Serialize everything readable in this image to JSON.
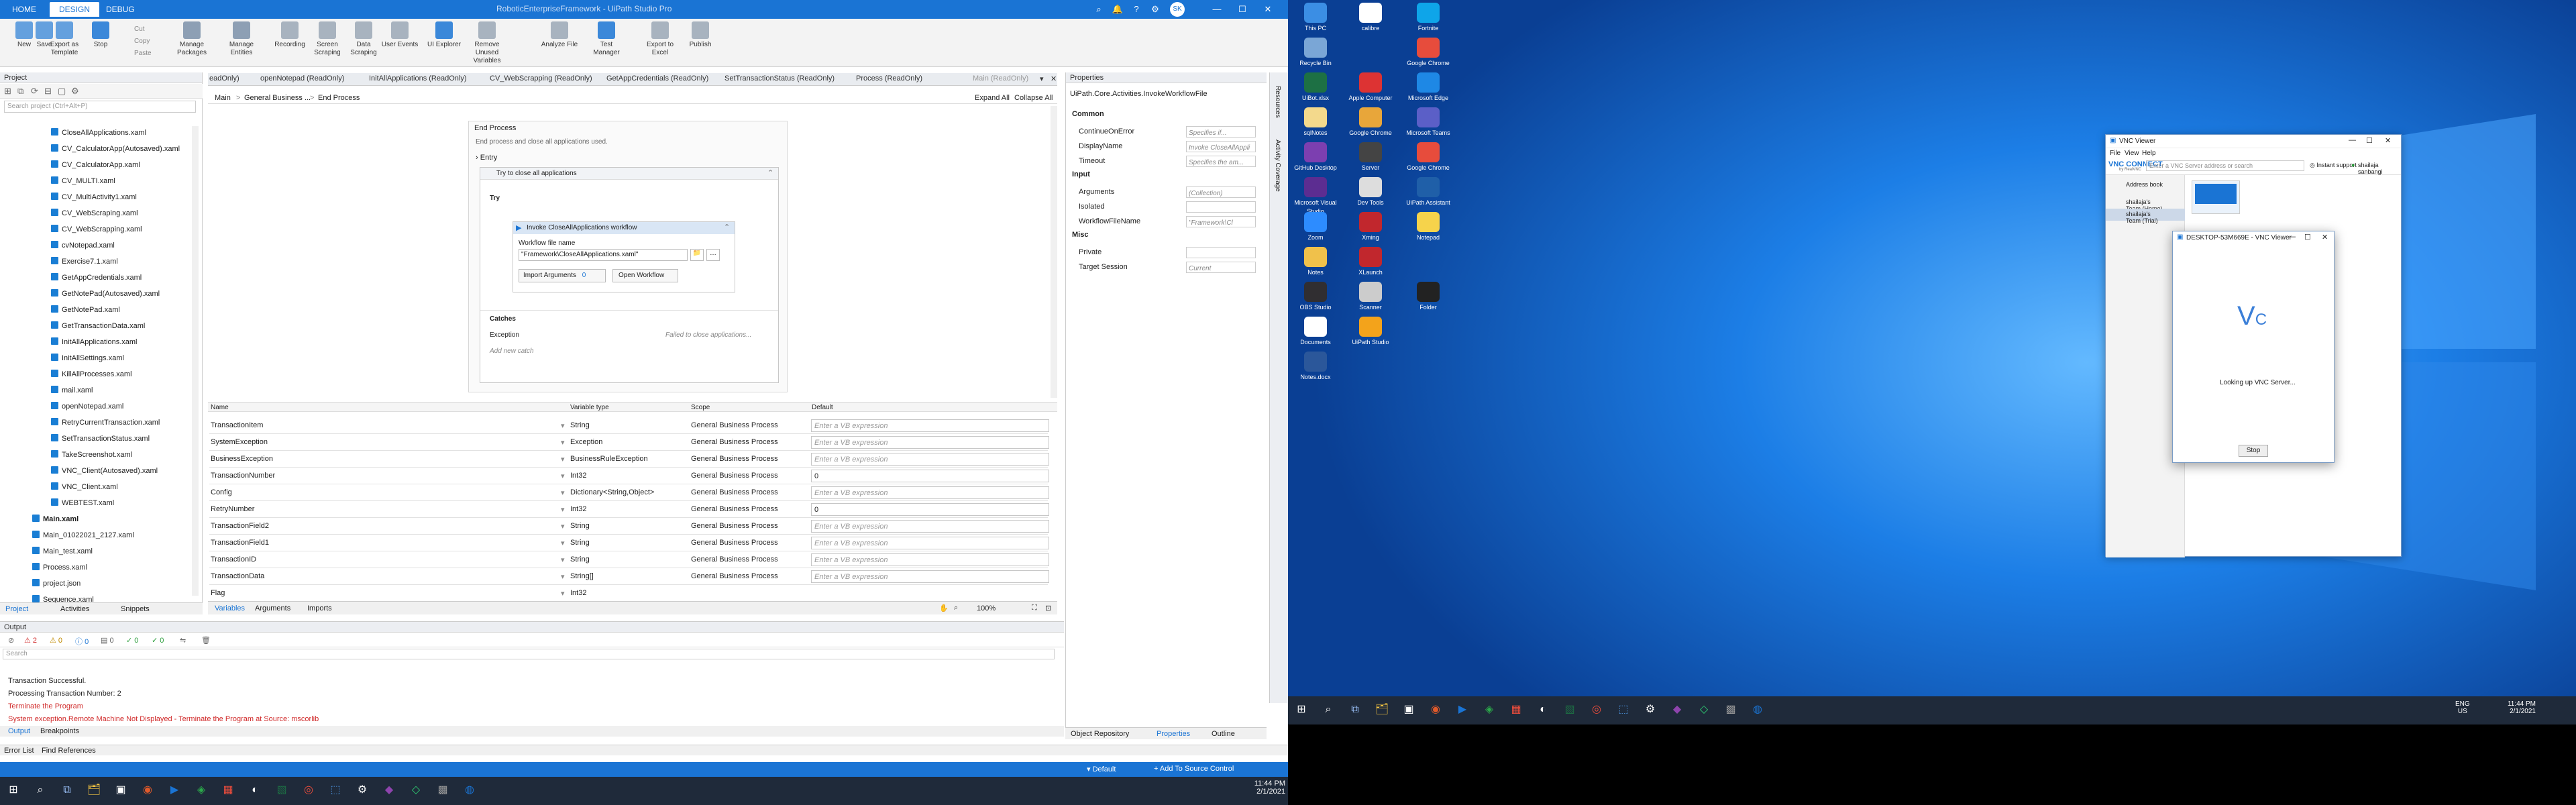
{
  "studio": {
    "title": "RoboticEnterpriseFramework - UiPath Studio Pro",
    "tabs": [
      "HOME",
      "DESIGN",
      "DEBUG"
    ],
    "user_initials": "SK",
    "ribbon": [
      {
        "label": "New",
        "icon": "new-icon"
      },
      {
        "label": "Save",
        "icon": "save-icon"
      },
      {
        "label": "Export as Template",
        "icon": "export-icon"
      },
      {
        "label": "Stop",
        "icon": "stop-icon"
      },
      {
        "label": "Manage Packages",
        "icon": "packages-icon"
      },
      {
        "label": "Manage Entities",
        "icon": "entities-icon"
      },
      {
        "label": "Recording",
        "icon": "recording-icon"
      },
      {
        "label": "Screen Scraping",
        "icon": "screen-scraping-icon"
      },
      {
        "label": "Data Scraping",
        "icon": "data-scraping-icon"
      },
      {
        "label": "User Events",
        "icon": "user-events-icon"
      },
      {
        "label": "UI Explorer",
        "icon": "ui-explorer-icon"
      },
      {
        "label": "Remove Unused Variables",
        "icon": "remove-variables-icon"
      },
      {
        "label": "Analyze File",
        "icon": "analyze-icon"
      },
      {
        "label": "Test Manager",
        "icon": "test-manager-icon"
      },
      {
        "label": "Export to Excel",
        "icon": "excel-export-icon"
      },
      {
        "label": "Publish",
        "icon": "publish-icon"
      }
    ],
    "ribbon_small": [
      "Cut",
      "Copy",
      "Paste"
    ],
    "project": {
      "header": "Project",
      "search_placeholder": "Search project (Ctrl+Alt+P)",
      "files": [
        "CloseAllApplications.xaml",
        "CV_CalculatorApp(Autosaved).xaml",
        "CV_CalculatorApp.xaml",
        "CV_MULTI.xaml",
        "CV_MultiActivity1.xaml",
        "CV_WebScraping.xaml",
        "CV_WebScrapping.xaml",
        "cvNotepad.xaml",
        "Exercise7.1.xaml",
        "GetAppCredentials.xaml",
        "GetNotePad(Autosaved).xaml",
        "GetNotePad.xaml",
        "GetTransactionData.xaml",
        "InitAllApplications.xaml",
        "InitAllSettings.xaml",
        "KillAllProcesses.xaml",
        "mail.xaml",
        "openNotepad.xaml",
        "RetryCurrentTransaction.xaml",
        "SetTransactionStatus.xaml",
        "TakeScreenshot.xaml",
        "VNC_Client(Autosaved).xaml",
        "VNC_Client.xaml",
        "WEBTEST.xaml",
        "Main.xaml",
        "Main_01022021_2127.xaml",
        "Main_test.xaml",
        "Process.xaml",
        "project.json",
        "Sequence.xaml"
      ],
      "bottom_tabs": [
        "Project",
        "Activities",
        "Snippets"
      ]
    },
    "doc_tabs": [
      "eadOnly)",
      "openNotepad (ReadOnly)",
      "InitAllApplications (ReadOnly)",
      "CV_WebScrapping (ReadOnly)",
      "GetAppCredentials (ReadOnly)",
      "SetTransactionStatus (ReadOnly)",
      "Process (ReadOnly)",
      "Main (ReadOnly)"
    ],
    "breadcrumb": [
      "Main",
      "General Business ...",
      "End Process"
    ],
    "expand_all": "Expand All",
    "collapse_all": "Collapse All",
    "workflow": {
      "state_title": "End Process",
      "state_desc": "End process and close all applications used.",
      "entry": "Entry",
      "try_catch_title": "Try to close all applications",
      "try_label": "Try",
      "invoke_title": "Invoke CloseAllApplications workflow",
      "file_name_label": "Workflow file name",
      "file_name_value": "\"Framework\\CloseAllApplications.xaml\"",
      "import_args": "Import Arguments",
      "import_args_count": "0",
      "open_workflow": "Open Workflow",
      "catches": "Catches",
      "exception": "Exception",
      "exception_msg": "Failed to close applications...",
      "add_catch": "Add new catch"
    },
    "variables": {
      "headers": [
        "Name",
        "Variable type",
        "Scope",
        "Default"
      ],
      "rows": [
        {
          "name": "TransactionItem",
          "type": "String",
          "scope": "General Business Process",
          "default": "Enter a VB expression",
          "placeholder": true
        },
        {
          "name": "SystemException",
          "type": "Exception",
          "scope": "General Business Process",
          "default": "Enter a VB expression",
          "placeholder": true
        },
        {
          "name": "BusinessException",
          "type": "BusinessRuleException",
          "scope": "General Business Process",
          "default": "Enter a VB expression",
          "placeholder": true
        },
        {
          "name": "TransactionNumber",
          "type": "Int32",
          "scope": "General Business Process",
          "default": "0",
          "placeholder": false
        },
        {
          "name": "Config",
          "type": "Dictionary<String,Object>",
          "scope": "General Business Process",
          "default": "Enter a VB expression",
          "placeholder": true
        },
        {
          "name": "RetryNumber",
          "type": "Int32",
          "scope": "General Business Process",
          "default": "0",
          "placeholder": false
        },
        {
          "name": "TransactionField2",
          "type": "String",
          "scope": "General Business Process",
          "default": "Enter a VB expression",
          "placeholder": true
        },
        {
          "name": "TransactionField1",
          "type": "String",
          "scope": "General Business Process",
          "default": "Enter a VB expression",
          "placeholder": true
        },
        {
          "name": "TransactionID",
          "type": "String",
          "scope": "General Business Process",
          "default": "Enter a VB expression",
          "placeholder": true
        },
        {
          "name": "TransactionData",
          "type": "String[]",
          "scope": "General Business Process",
          "default": "Enter a VB expression",
          "placeholder": true
        },
        {
          "name": "Flag",
          "type": "Int32",
          "scope": "",
          "default": "",
          "placeholder": false
        }
      ],
      "bottom_tabs": [
        "Variables",
        "Arguments",
        "Imports"
      ],
      "zoom": "100%"
    },
    "properties": {
      "header": "Properties",
      "type_name": "UiPath.Core.Activities.InvokeWorkflowFile",
      "groups": [
        {
          "name": "Common",
          "rows": [
            {
              "k": "ContinueOnError",
              "v": "Specifies if..."
            },
            {
              "k": "DisplayName",
              "v": "Invoke CloseAllAppli"
            },
            {
              "k": "Timeout",
              "v": "Specifies the am..."
            }
          ]
        },
        {
          "name": "Input",
          "rows": [
            {
              "k": "Arguments",
              "v": "(Collection)"
            },
            {
              "k": "Isolated",
              "v": ""
            },
            {
              "k": "WorkflowFileName",
              "v": "\"Framework\\Cl"
            }
          ]
        },
        {
          "name": "Misc",
          "rows": [
            {
              "k": "Private",
              "v": ""
            },
            {
              "k": "Target Session",
              "v": "Current"
            }
          ]
        }
      ],
      "side_tabs": [
        "Resources",
        "Activity Coverage"
      ],
      "bottom_tabs": [
        "Object Repository",
        "Properties",
        "Outline"
      ]
    },
    "output": {
      "header": "Output",
      "counts": [
        "2",
        "0",
        "0",
        "0",
        "0",
        "0"
      ],
      "search_placeholder": "Search",
      "lines": [
        {
          "text": "Transaction Successful.",
          "color": "#222"
        },
        {
          "text": "Processing Transaction Number: 2",
          "color": "#222"
        },
        {
          "text": "Terminate the Program",
          "color": "#d12b2b"
        },
        {
          "text": "System exception.Remote Machine Not Displayed - Terminate the Program at Source: mscorlib",
          "color": "#d12b2b"
        }
      ],
      "bottom_tabs": [
        "Output",
        "Breakpoints"
      ],
      "bottom_tabs2": [
        "Error List",
        "Find References"
      ]
    },
    "statusbar": {
      "default": "Default",
      "source_control": "Add To Source Control"
    },
    "taskbar": {
      "time": "11:44 PM",
      "date": "2/1/2021"
    }
  },
  "desktop": {
    "icons": [
      {
        "label": "This PC",
        "col": 0,
        "row": 0,
        "color": "#3b8ee4"
      },
      {
        "label": "Recycle Bin",
        "col": 0,
        "row": 1,
        "color": "#7aa6d6"
      },
      {
        "label": "UiBot.xlsx",
        "col": 0,
        "row": 2,
        "color": "#1d7044"
      },
      {
        "label": "sqlNotes",
        "col": 0,
        "row": 3,
        "color": "#f3d98c"
      },
      {
        "label": "GitHub Desktop",
        "col": 0,
        "row": 4,
        "color": "#7c3fb0"
      },
      {
        "label": "Microsoft Visual Studio",
        "col": 0,
        "row": 5,
        "color": "#5c2d91"
      },
      {
        "label": "Zoom",
        "col": 0,
        "row": 6,
        "color": "#2d8cff"
      },
      {
        "label": "Notes",
        "col": 0,
        "row": 7,
        "color": "#f0c14b"
      },
      {
        "label": "OBS Studio",
        "col": 0,
        "row": 8,
        "color": "#302e31"
      },
      {
        "label": "Documents",
        "col": 0,
        "row": 9,
        "color": "#ffffff"
      },
      {
        "label": "Notes.docx",
        "col": 0,
        "row": 10,
        "color": "#2b579a"
      },
      {
        "label": "calibre",
        "col": 1,
        "row": 0,
        "color": "#ffffff"
      },
      {
        "label": "Apple Computer",
        "col": 1,
        "row": 2,
        "color": "#d33"
      },
      {
        "label": "Google Chrome",
        "col": 1,
        "row": 3,
        "color": "#e8a63a"
      },
      {
        "label": "Server",
        "col": 1,
        "row": 4,
        "color": "#444"
      },
      {
        "label": "Dev Tools",
        "col": 1,
        "row": 5,
        "color": "#ddd"
      },
      {
        "label": "Xming",
        "col": 1,
        "row": 6,
        "color": "#c1272d"
      },
      {
        "label": "XLaunch",
        "col": 1,
        "row": 7,
        "color": "#c1272d"
      },
      {
        "label": "Scanner",
        "col": 1,
        "row": 8,
        "color": "#ccc"
      },
      {
        "label": "UiPath Studio",
        "col": 1,
        "row": 9,
        "color": "#f3a31b"
      },
      {
        "label": "Fortnite",
        "col": 2,
        "row": 0,
        "color": "#0ea5e9"
      },
      {
        "label": "Google Chrome",
        "col": 2,
        "row": 1,
        "color": "#e74c3c"
      },
      {
        "label": "Microsoft Edge",
        "col": 2,
        "row": 2,
        "color": "#1e88e5"
      },
      {
        "label": "Microsoft Teams",
        "col": 2,
        "row": 3,
        "color": "#5b5fc7"
      },
      {
        "label": "Google Chrome",
        "col": 2,
        "row": 4,
        "color": "#e74c3c"
      },
      {
        "label": "UiPath Assistant",
        "col": 2,
        "row": 5,
        "color": "#1f5fa8"
      },
      {
        "label": "Notepad",
        "col": 2,
        "row": 6,
        "color": "#f6d34b"
      },
      {
        "label": "Folder",
        "col": 2,
        "row": 8,
        "color": "#222"
      }
    ]
  },
  "vnc": {
    "title": "VNC Viewer",
    "menu": [
      "File",
      "View",
      "Help"
    ],
    "brand": "VNC CONNECT",
    "brand_sub": "by RealVNC",
    "address_placeholder": "Enter a VNC Server address or search",
    "instant_support": "Instant support",
    "user": "shailaja sanbangi",
    "sidebar": [
      "Address book",
      "shailaja's Team (Home)",
      "shailaja's Team (Trial)"
    ],
    "dialog_title": "DESKTOP-53M669E - VNC Viewer",
    "looking_up": "Looking up VNC Server...",
    "stop": "Stop"
  },
  "taskbar2": {
    "lang": "ENG",
    "region": "US",
    "time": "11:44 PM",
    "date": "2/1/2021"
  }
}
